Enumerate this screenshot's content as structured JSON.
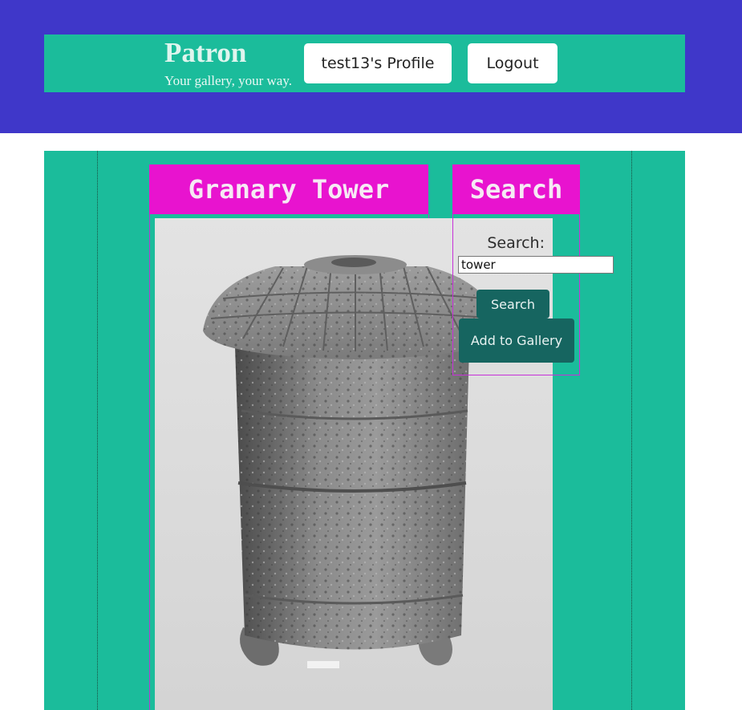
{
  "header": {
    "brand_name": "Patron",
    "tagline": "Your gallery, your way.",
    "profile_label": "test13's Profile",
    "logout_label": "Logout"
  },
  "artwork": {
    "title": "Granary Tower",
    "image_label": "Black and white photograph of a granary tower ceramic jar"
  },
  "search": {
    "heading": "Search",
    "label": "Search:",
    "query": "tower",
    "search_button": "Search",
    "add_button": "Add to Gallery"
  },
  "colors": {
    "top_band": "#3f37c9",
    "teal": "#1bbc9b",
    "magenta": "#e813cf",
    "dark_teal_button": "#166560"
  }
}
